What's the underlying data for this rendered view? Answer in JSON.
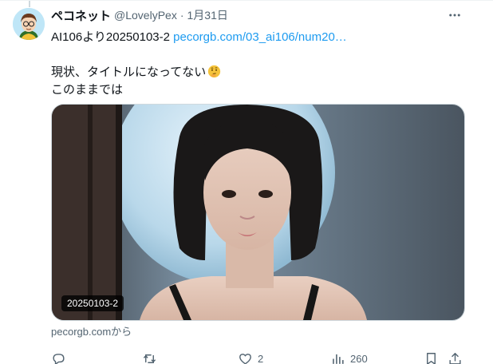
{
  "tweet": {
    "author": {
      "display_name": "ペコネット",
      "handle": "@LovelyPex",
      "separator": "·",
      "date": "1月31日"
    },
    "text": {
      "line1_prefix": "AI106より20250103-2 ",
      "line1_link": "pecorgb.com/03_ai106/num20…",
      "line2": "現状、タイトルになってない",
      "line2_emoji": "thinking-face-emoji",
      "line3": "このままでは"
    },
    "media": {
      "alt_badge": "20250103-2"
    },
    "source": "pecorgb.comから",
    "actions": {
      "reply_count": "",
      "retweet_count": "",
      "like_count": "2",
      "views_count": "260"
    }
  },
  "icons": {
    "more": "more-horizontal-icon",
    "reply": "reply-icon",
    "retweet": "retweet-icon",
    "like": "heart-icon",
    "views": "analytics-icon",
    "bookmark": "bookmark-icon",
    "share": "share-icon"
  },
  "colors": {
    "link": "#1d9bf0",
    "secondary_text": "#536471",
    "primary_text": "#0f1419"
  }
}
